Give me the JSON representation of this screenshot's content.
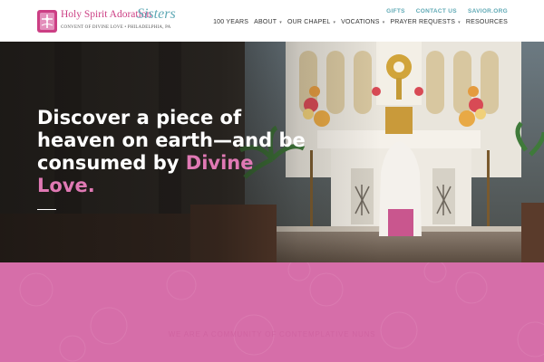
{
  "logo": {
    "title": "Holy Spirit Adoration",
    "script": "Sisters",
    "subtitle": "CONVENT OF DIVINE LOVE • PHILADELPHIA, PA"
  },
  "util_nav": [
    "GIFTS",
    "CONTACT US",
    "SAVIOR.ORG"
  ],
  "main_nav": [
    {
      "label": "100 YEARS",
      "has_dropdown": false
    },
    {
      "label": "ABOUT",
      "has_dropdown": true
    },
    {
      "label": "OUR CHAPEL",
      "has_dropdown": true
    },
    {
      "label": "VOCATIONS",
      "has_dropdown": true
    },
    {
      "label": "PRAYER REQUESTS",
      "has_dropdown": true
    },
    {
      "label": "RESOURCES",
      "has_dropdown": false
    }
  ],
  "hero": {
    "headline_part1": "Discover a piece of heaven on earth—and be consumed by ",
    "headline_accent": "Divine Love."
  },
  "band": {
    "text": "WE ARE A COMMUNITY OF CONTEMPLATIVE NUNS"
  },
  "colors": {
    "brand_pink": "#cc3f84",
    "brand_teal": "#5fa9b5",
    "band_pink": "#d66ea9",
    "accent_pink": "#e079b4"
  },
  "icons": {
    "logo_mark": "book-and-dove-icon",
    "nav_dropdown": "chevron-down-icon"
  }
}
